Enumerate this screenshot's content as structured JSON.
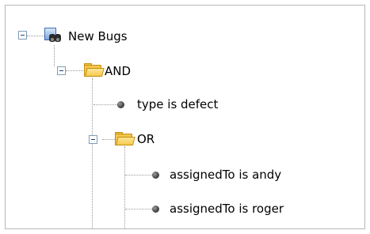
{
  "tree": {
    "root": {
      "label": "New Bugs",
      "icon": "binoculars-query-icon",
      "expanded": true,
      "children": {
        "and_group": {
          "label": "AND",
          "icon": "folder-open-icon",
          "expanded": true,
          "children": {
            "type_condition": {
              "label": "type is defect",
              "icon": "bullet-icon"
            },
            "or_group": {
              "label": "OR",
              "icon": "folder-open-icon",
              "expanded": true,
              "children": {
                "andy": {
                  "label": "assignedTo is andy",
                  "icon": "bullet-icon"
                },
                "roger": {
                  "label": "assignedTo is roger",
                  "icon": "bullet-icon"
                }
              }
            }
          }
        }
      }
    }
  },
  "colors": {
    "border": "#b7b7b7",
    "folder": "#f5c64a",
    "connector": "#9a9a9a",
    "expander_border": "#7f9db9"
  }
}
